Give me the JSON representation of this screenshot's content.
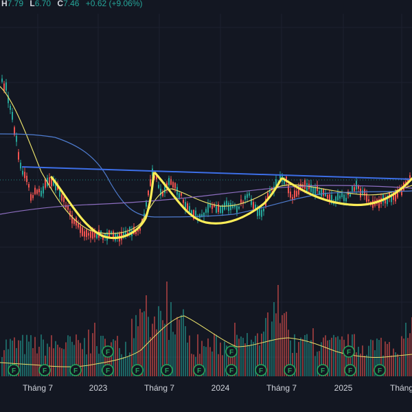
{
  "header": {
    "high_key": "H",
    "high_val": "7.79",
    "low_key": "L",
    "low_val": "6.70",
    "close_key": "C",
    "close_val": "7.46",
    "change": "+0.62 (+9.06%)"
  },
  "colors": {
    "background": "#131722",
    "up": "#26a69a",
    "down": "#ef5350",
    "ma_short": "#e9e06b",
    "ma_long": "#4f7dd1",
    "ma_purple": "#8e6fc2",
    "trendline": "#3d6fe8",
    "pattern": "#ffee58",
    "event_badge": "#26a65b"
  },
  "chart_data": {
    "type": "candlestick",
    "x_labels": [
      "Tháng 7",
      "2023",
      "Tháng 7",
      "2024",
      "Tháng 7",
      "2025",
      "Tháng"
    ],
    "price_range": [
      5.0,
      9.5
    ],
    "last": {
      "high": 7.79,
      "low": 6.7,
      "close": 7.46,
      "change": 0.62,
      "change_pct": 9.06
    },
    "annotations": [
      "neckline",
      "cup",
      "cup",
      "cup"
    ],
    "event_marker_label": "F",
    "event_marker_count": 16,
    "indicators": [
      "MA short (yellow)",
      "MA long (blue)",
      "MA (purple)",
      "Volume MA (yellow)"
    ]
  }
}
